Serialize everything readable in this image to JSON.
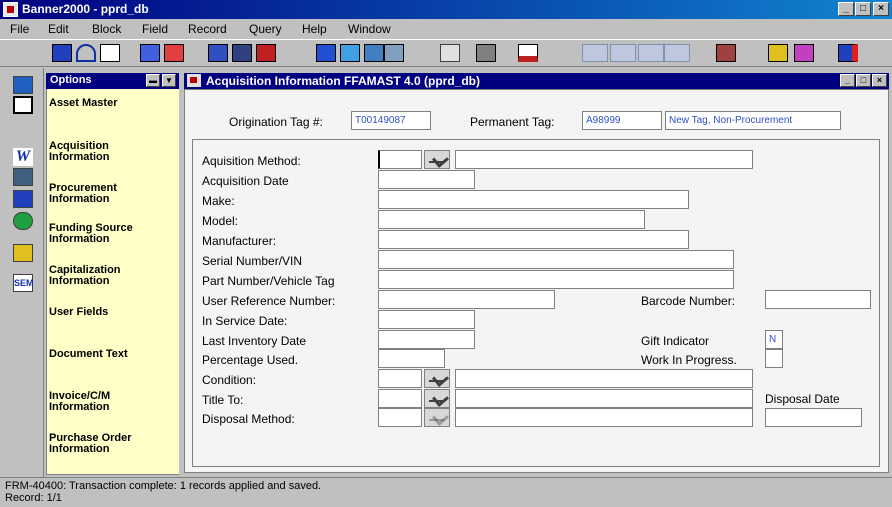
{
  "app": {
    "title": "Banner2000 - pprd_db",
    "minimize": "_",
    "maximize": "□",
    "close": "×"
  },
  "menu": [
    "File",
    "Edit",
    "Block",
    "Field",
    "Record",
    "Query",
    "Help",
    "Window"
  ],
  "toolbar_icons": [
    "save-icon",
    "rollback-icon",
    "exit-icon",
    "previous-block-icon",
    "next-block-icon",
    "insert-record-icon",
    "delete-record-icon",
    "clear-record-icon",
    "list-values-icon",
    "print-icon",
    "help-icon",
    "query-icon",
    "chart-icon",
    "misc-icon",
    "options-icon",
    "exit-form-icon"
  ],
  "left_strip_icons": [
    "calendar-icon",
    "grid-icon",
    "word-icon",
    "excel-icon",
    "mail-icon",
    "globe-icon",
    "directory-icon",
    "sem-icon"
  ],
  "left_strip_label_sem": "SEM",
  "options": {
    "title": "Options",
    "items": [
      "Asset Master",
      "Acquisition Information",
      "Procurement Information",
      "Funding Source Information",
      "Capitalization Information",
      "User Fields",
      "Document Text",
      "Invoice/C/M Information",
      "Purchase Order Information"
    ]
  },
  "form": {
    "title": "Acquisition Information  FFAMAST  4.0  (pprd_db)",
    "origination_tag_label": "Origination Tag #:",
    "origination_tag_value": "T00149087",
    "permanent_tag_label": "Permanent Tag:",
    "permanent_tag_value": "A98999",
    "permanent_tag_desc": "New Tag, Non-Procurement",
    "fields": {
      "acquisition_method": "Aquisition Method:",
      "acquisition_date": "Acquisition Date",
      "make": "Make:",
      "model": "Model:",
      "manufacturer": "Manufacturer:",
      "serial_number": "Serial Number/VIN",
      "part_number": "Part Number/Vehicle Tag",
      "user_reference": "User Reference Number:",
      "barcode": "Barcode Number:",
      "in_service_date": "In Service Date:",
      "last_inventory_date": "Last Inventory Date",
      "gift_indicator": "Gift Indicator",
      "gift_indicator_value": "N",
      "percentage_used": "Percentage Used.",
      "work_in_progress": "Work In Progress.",
      "condition": "Condition:",
      "title_to": "Title To:",
      "disposal_date": "Disposal Date",
      "disposal_method": "Disposal Method:"
    }
  },
  "status": {
    "message": "FRM-40400: Transaction complete: 1 records applied and saved.",
    "record": "Record: 1/1"
  }
}
